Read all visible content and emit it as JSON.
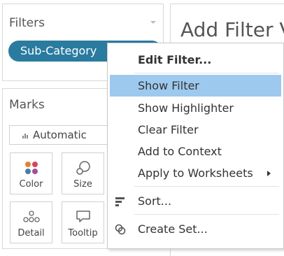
{
  "filters": {
    "title": "Filters",
    "pill_label": "Sub-Category"
  },
  "marks": {
    "title": "Marks",
    "mark_type": "Automatic",
    "buttons": [
      {
        "label": "Color",
        "icon": "color-dots-icon"
      },
      {
        "label": "Size",
        "icon": "size-circles-icon"
      },
      {
        "label": "Detail",
        "icon": "detail-dots-icon"
      },
      {
        "label": "Tooltip",
        "icon": "tooltip-speech-icon"
      }
    ]
  },
  "sheet": {
    "title": "Add Filter V"
  },
  "context_menu": {
    "items": [
      {
        "label": "Edit Filter...",
        "bold": true
      },
      {
        "label": "Show Filter",
        "highlighted": true
      },
      {
        "label": "Show Highlighter"
      },
      {
        "label": "Clear Filter"
      },
      {
        "label": "Add to Context"
      },
      {
        "label": "Apply to Worksheets",
        "submenu": true
      },
      {
        "label": "Sort...",
        "icon": "sort-icon"
      },
      {
        "label": "Create Set...",
        "icon": "create-set-icon"
      }
    ]
  },
  "colors": {
    "pill": "#2a7ba0",
    "highlight": "#9ec9ef",
    "color_dots": [
      "#e6812f",
      "#d1495b",
      "#4e79a7",
      "#a05195"
    ]
  }
}
